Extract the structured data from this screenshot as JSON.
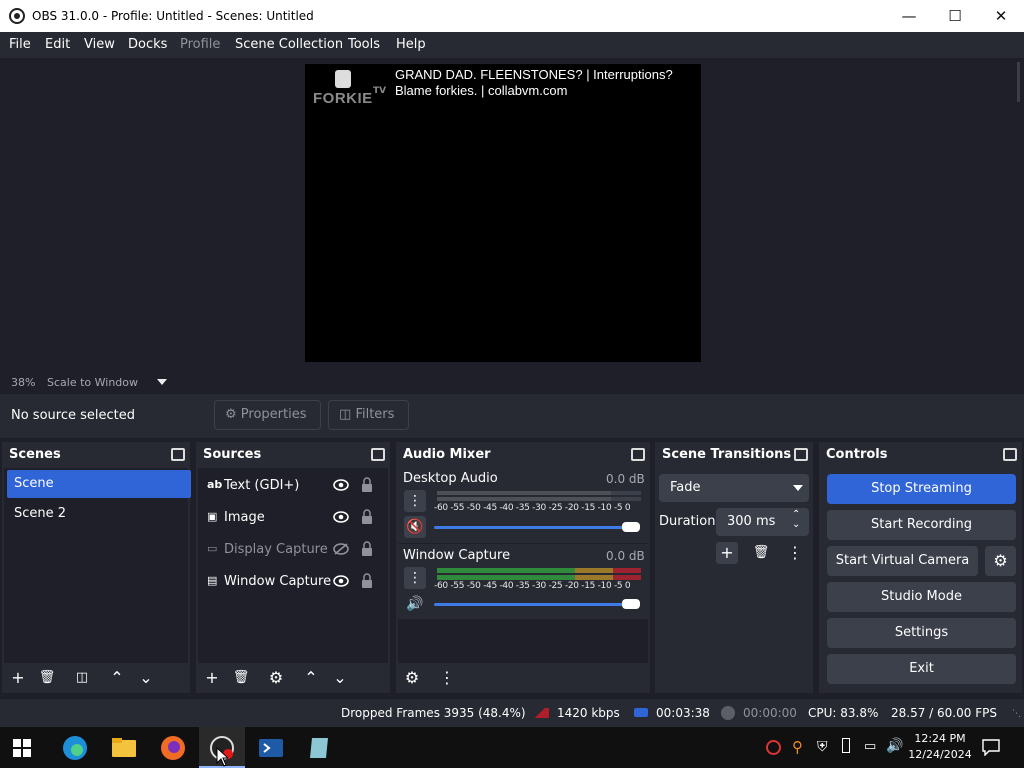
{
  "window": {
    "title": "OBS 31.0.0 - Profile: Untitled - Scenes: Untitled"
  },
  "menu": [
    "File",
    "Edit",
    "View",
    "Docks",
    "Profile",
    "Scene Collection",
    "Tools",
    "Help"
  ],
  "preview": {
    "overlay_text": [
      "GRAND DAD. FLEENSTONES? | Interruptions?",
      "Blame forkies. | collabvm.com"
    ],
    "logo_text": "FORKIE",
    "logo_sub": "TV"
  },
  "zoom": {
    "value": "38%",
    "mode": "Scale to Window"
  },
  "context": {
    "no_source": "No source selected",
    "properties": "Properties",
    "filters": "Filters"
  },
  "scenes": {
    "title": "Scenes",
    "items": [
      "Scene",
      "Scene 2"
    ],
    "selected": 0
  },
  "sources": {
    "title": "Sources",
    "items": [
      {
        "label": "Text (GDI+)",
        "icon": "text-icon",
        "visible": true
      },
      {
        "label": "Image",
        "icon": "image-icon",
        "visible": true
      },
      {
        "label": "Display Capture",
        "icon": "monitor-icon",
        "visible": false
      },
      {
        "label": "Window Capture",
        "icon": "window-icon",
        "visible": true
      }
    ]
  },
  "mixer": {
    "title": "Audio Mixer",
    "channels": [
      {
        "name": "Desktop Audio",
        "db": "0.0 dB",
        "muted": true
      },
      {
        "name": "Window Capture",
        "db": "0.0 dB",
        "muted": false
      }
    ],
    "scale": "-60 -55 -50 -45 -40 -35 -30 -25 -20 -15 -10  -5   0"
  },
  "transitions": {
    "title": "Scene Transitions",
    "selected": "Fade",
    "duration_label": "Duration",
    "duration": "300 ms"
  },
  "controls": {
    "title": "Controls",
    "buttons": [
      "Stop Streaming",
      "Start Recording",
      "Start Virtual Camera",
      "Studio Mode",
      "Settings",
      "Exit"
    ]
  },
  "status": {
    "dropped": "Dropped Frames 3935 (48.4%)",
    "bitrate": "1420 kbps",
    "stream_time": "00:03:38",
    "rec_time": "00:00:00",
    "cpu": "CPU: 83.8%",
    "fps": "28.57 / 60.00 FPS"
  },
  "taskbar": {
    "time": "12:24 PM",
    "date": "12/24/2024"
  },
  "colors": {
    "accent": "#2f65d6",
    "panel": "#272a33",
    "background": "#1e1f29",
    "button": "#3c404b"
  }
}
